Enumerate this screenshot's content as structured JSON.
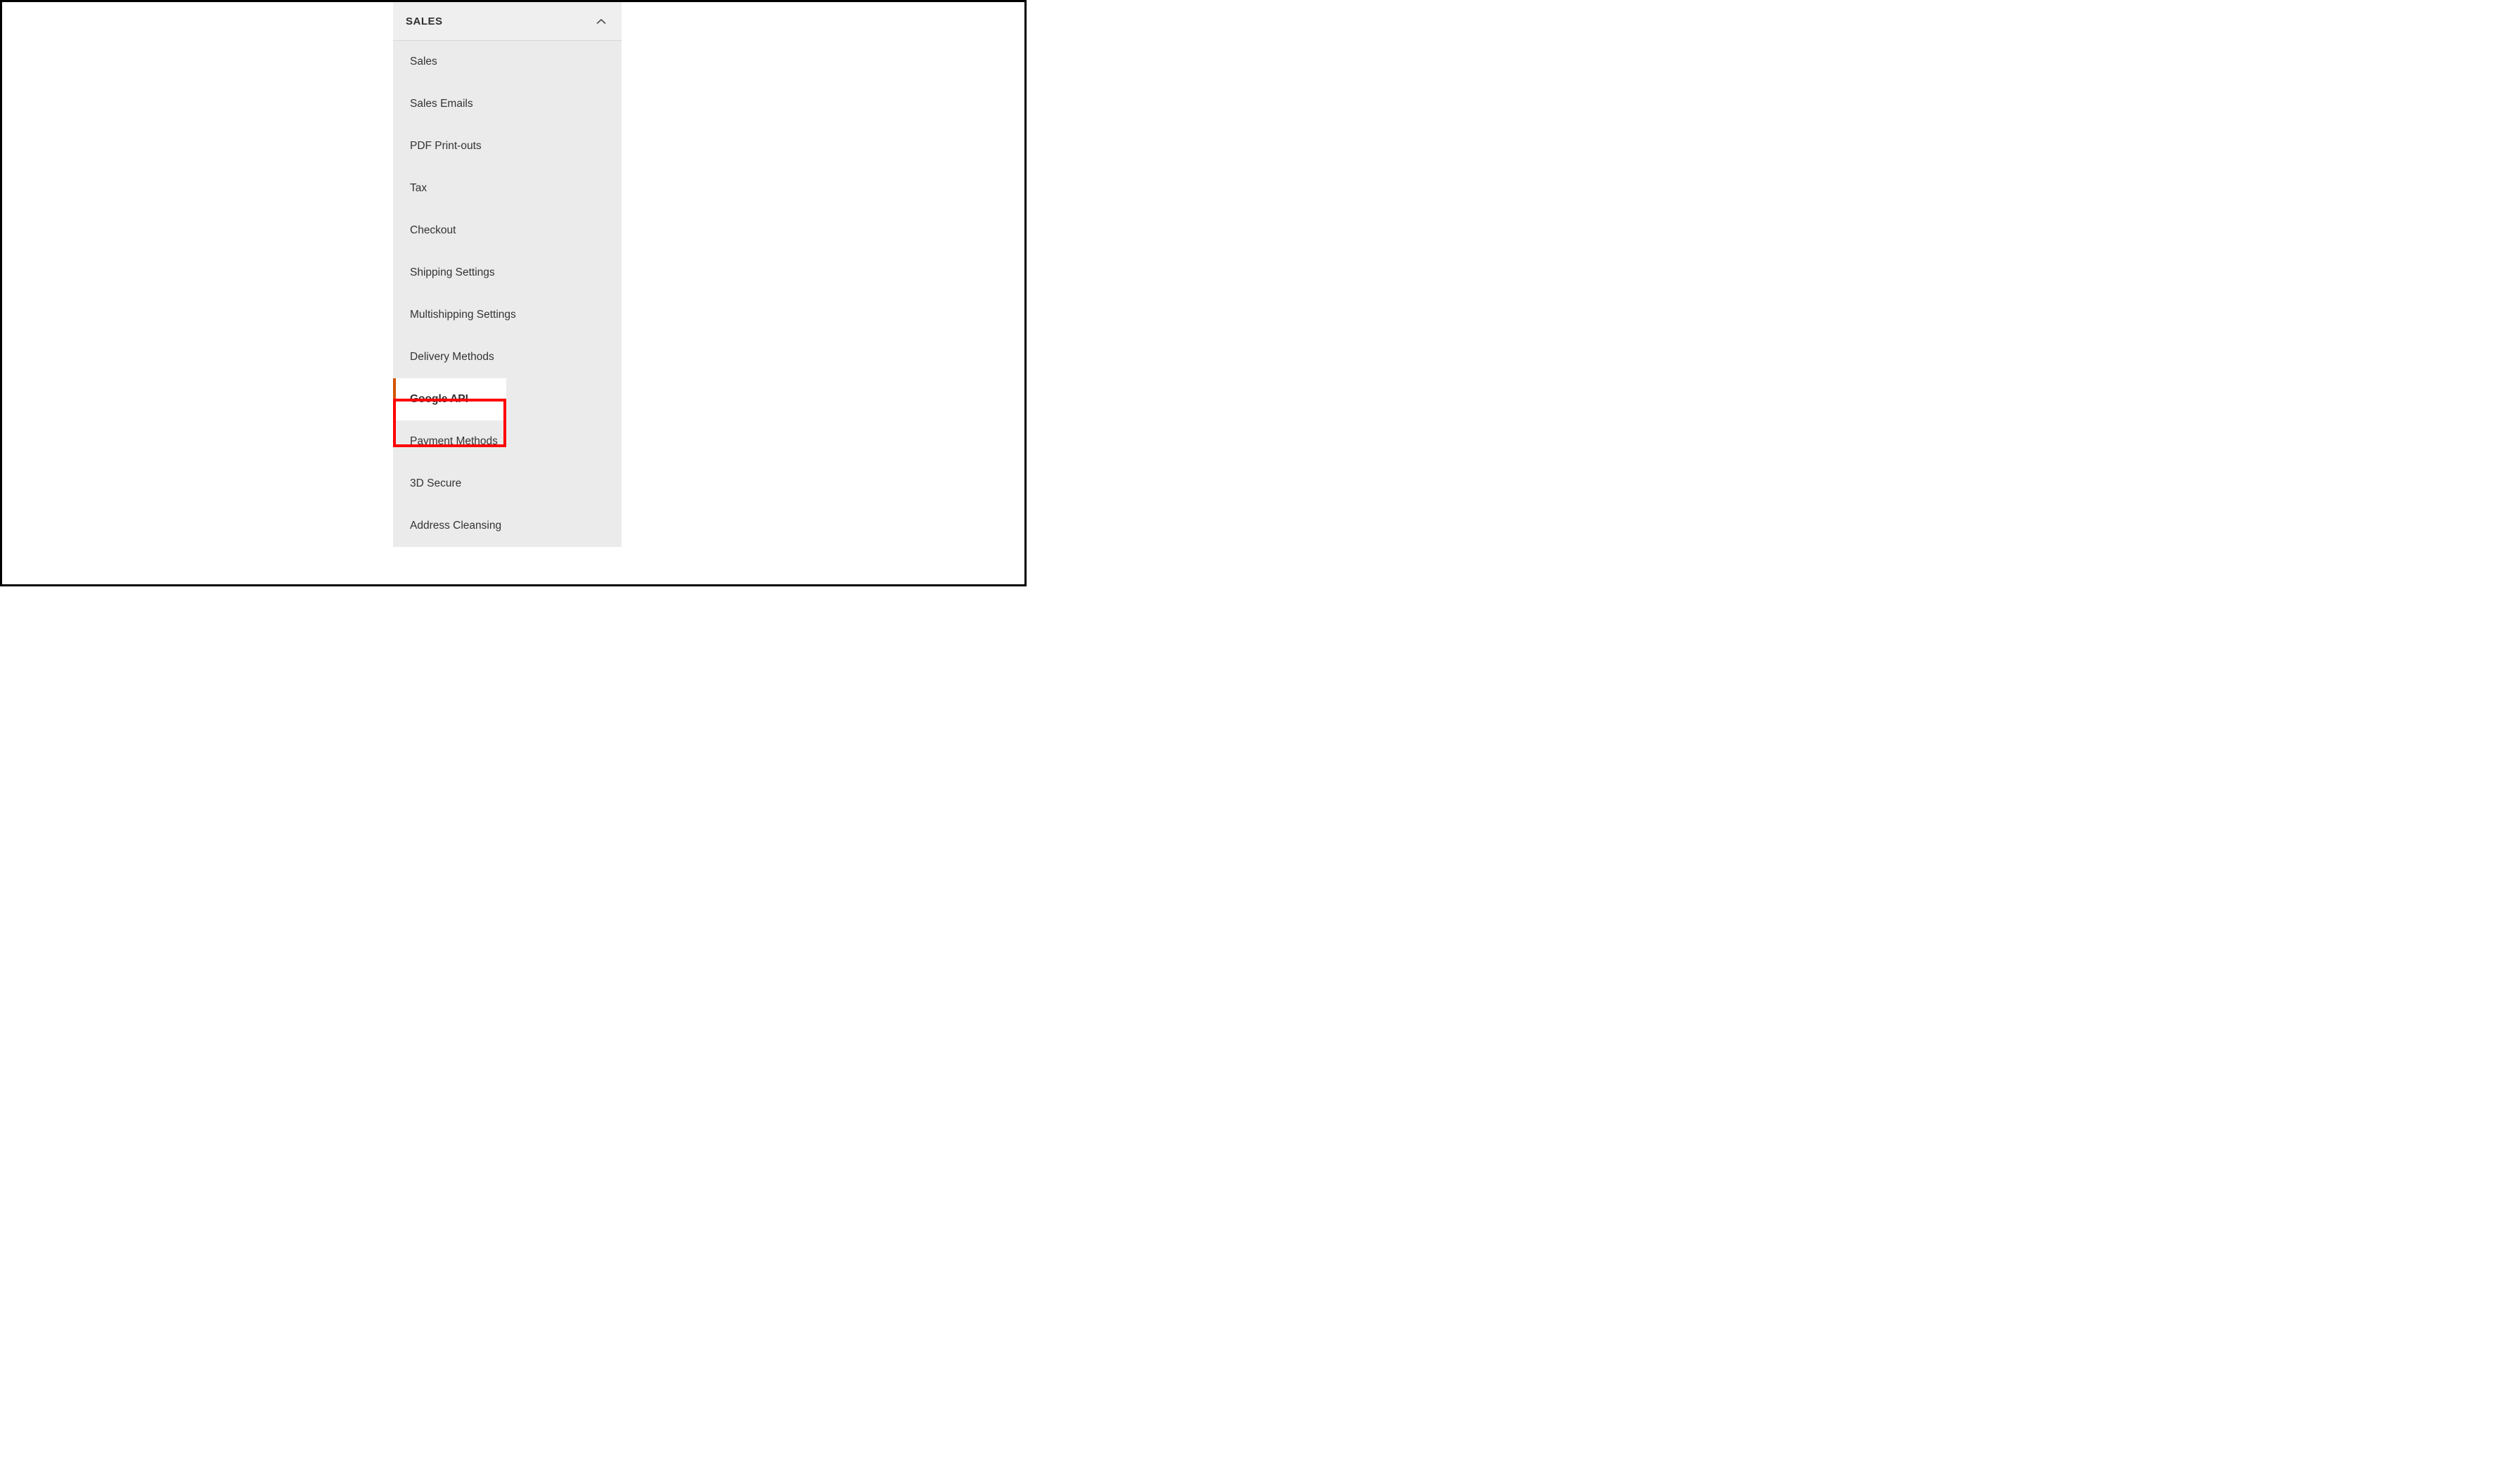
{
  "sidebar": {
    "section_title": "SALES",
    "items": [
      {
        "label": "Sales",
        "active": false
      },
      {
        "label": "Sales Emails",
        "active": false
      },
      {
        "label": "PDF Print-outs",
        "active": false
      },
      {
        "label": "Tax",
        "active": false
      },
      {
        "label": "Checkout",
        "active": false
      },
      {
        "label": "Shipping Settings",
        "active": false
      },
      {
        "label": "Multishipping Settings",
        "active": false
      },
      {
        "label": "Delivery Methods",
        "active": false
      },
      {
        "label": "Google API",
        "active": true
      },
      {
        "label": "Payment Methods",
        "active": false
      },
      {
        "label": "3D Secure",
        "active": false
      },
      {
        "label": "Address Cleansing",
        "active": false
      }
    ]
  }
}
